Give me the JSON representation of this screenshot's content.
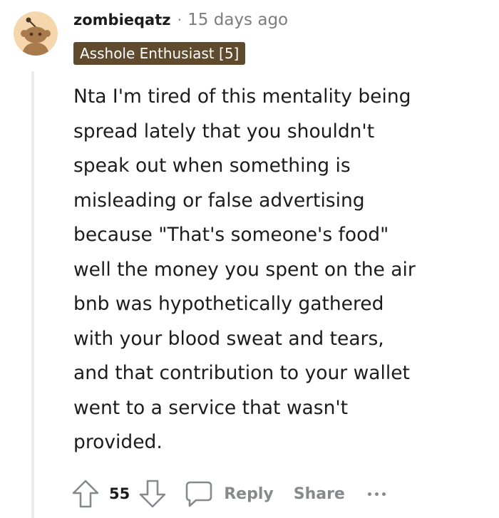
{
  "comment": {
    "author": "zombieqatz",
    "separator": "·",
    "timestamp": "15 days ago",
    "flair": "Asshole Enthusiast [5]",
    "body_lines": [
      "Nta I'm tired of this mentality being",
      "spread lately that you shouldn't",
      "speak out when something is",
      "misleading or false advertising",
      "because \"That's someone's food\"",
      "well the money you spent on the air",
      "bnb was hypothetically gathered",
      "with your blood sweat and tears,",
      "and that contribution to your wallet",
      "went to a service that wasn't",
      "provided."
    ]
  },
  "actions": {
    "vote_count": "55",
    "reply_label": "Reply",
    "share_label": "Share"
  },
  "icons": {
    "avatar": "reddit-snoo-avatar",
    "upvote": "upvote-arrow-icon",
    "downvote": "downvote-arrow-icon",
    "reply": "speech-bubble-icon",
    "more": "more-horizontal-icon"
  },
  "colors": {
    "flair_bg": "#5f4a2d",
    "avatar_bg": "#f6d7ad",
    "meta_gray": "#878a8c",
    "text": "#1c1c1c"
  }
}
